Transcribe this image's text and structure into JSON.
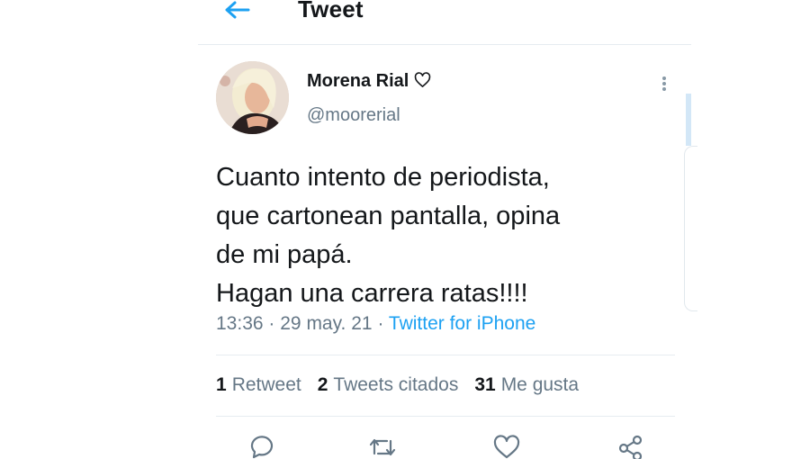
{
  "header": {
    "title": "Tweet",
    "back_icon": "arrow-left-icon"
  },
  "tweet": {
    "author_name": "Morena Rial",
    "verified_icon": "heart-outline-icon",
    "handle": "@moorerial",
    "text": "Cuanto intento de periodista,\nque cartonean pantalla, opina\nde mi papá.\nHagan una carrera ratas!!!!",
    "time": "13:36",
    "date": "29 may. 21",
    "separator": "·",
    "source": "Twitter for iPhone"
  },
  "stats": {
    "retweets_count": "1",
    "retweets_label": "Retweet",
    "quotes_count": "2",
    "quotes_label": "Tweets citados",
    "likes_count": "31",
    "likes_label": "Me gusta"
  },
  "actions": [
    "reply-icon",
    "retweet-icon",
    "like-icon",
    "share-icon"
  ],
  "colors": {
    "accent": "#1da1f2",
    "text": "#14171a",
    "secondary": "#657786",
    "divider": "#e6ecf0"
  }
}
